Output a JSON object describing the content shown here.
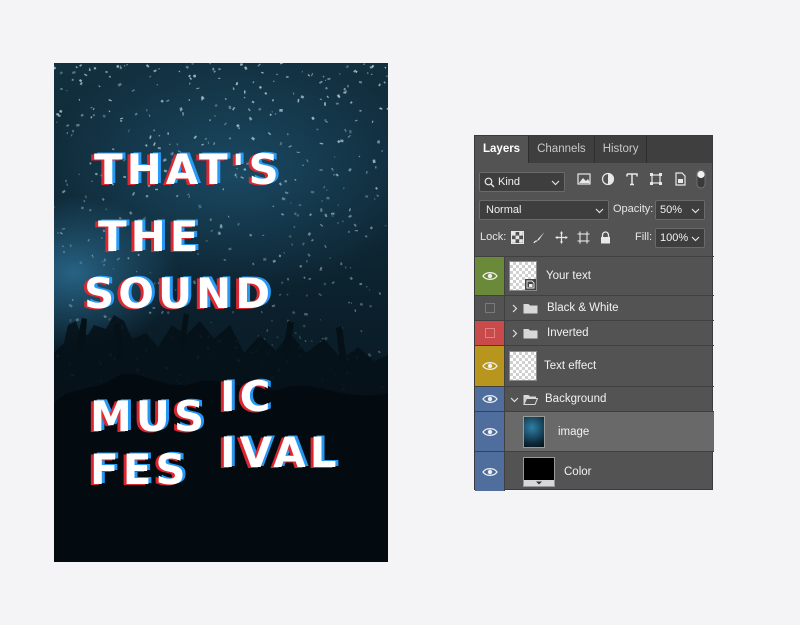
{
  "poster": {
    "lines": [
      "THAT'S",
      "THE",
      "SOUND",
      "IC",
      "MUS",
      "IVAL",
      "FES"
    ]
  },
  "layers_panel": {
    "tabs": [
      "Layers",
      "Channels",
      "History"
    ],
    "filter": {
      "kind_label": "Kind"
    },
    "blend": {
      "mode": "Normal",
      "opacity_label": "Opacity:",
      "opacity": "50%"
    },
    "lock": {
      "lock_label": "Lock:",
      "fill_label": "Fill:",
      "fill": "100%"
    },
    "layers": [
      {
        "name": "Your text",
        "color": "#6a8a3a",
        "visible": true,
        "kind": "smart-object"
      },
      {
        "name": "Black & White",
        "color": "#535353",
        "visible": false,
        "kind": "group"
      },
      {
        "name": "Inverted",
        "color": "#c84a4a",
        "visible": false,
        "kind": "group"
      },
      {
        "name": "Text effect",
        "color": "#b8961e",
        "visible": true,
        "kind": "pixel"
      },
      {
        "name": "Background",
        "color": "#4f6e9e",
        "visible": true,
        "kind": "group-open"
      },
      {
        "name": "image",
        "color": "#4f6e9e",
        "visible": true,
        "kind": "image",
        "selected": true
      },
      {
        "name": "Color",
        "color": "#4f6e9e",
        "visible": true,
        "kind": "fill"
      }
    ]
  }
}
